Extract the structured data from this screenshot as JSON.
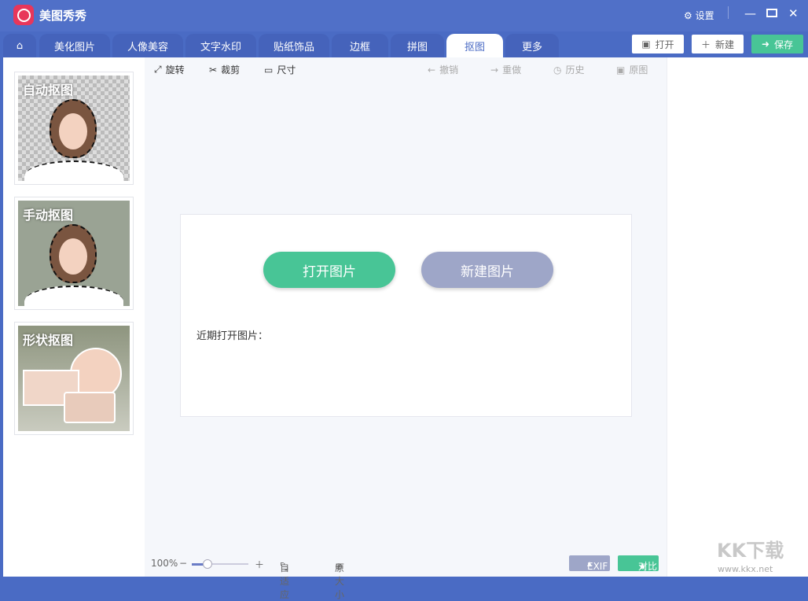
{
  "app": {
    "title": "美图秀秀",
    "settings": "设置"
  },
  "tabs": [
    "美化图片",
    "人像美容",
    "文字水印",
    "贴纸饰品",
    "边框",
    "拼图",
    "抠图",
    "更多"
  ],
  "active_tab": "抠图",
  "header_buttons": {
    "open": "打开",
    "new": "新建",
    "save": "保存"
  },
  "colors": {
    "titlebar": "#5070c8",
    "green": "#48c596",
    "gray_button": "#9ea6c8"
  },
  "sidebar": [
    {
      "label": "自动抠图"
    },
    {
      "label": "手动抠图"
    },
    {
      "label": "形状抠图"
    }
  ],
  "toolbar": {
    "rotate": "旋转",
    "crop": "裁剪",
    "size": "尺寸",
    "undo": "撤销",
    "redo": "重做",
    "history": "历史",
    "original": "原图"
  },
  "dialog": {
    "open_image": "打开图片",
    "new_image": "新建图片",
    "recent": "近期打开图片："
  },
  "bottom": {
    "zoom": "100%",
    "zoom_fraction": 0.28,
    "fit": "自适应",
    "actual_size": "原大小",
    "exif": "EXIF",
    "compare": "对比"
  },
  "watermark": {
    "text": "KK下载",
    "url": "www.kkx.net"
  }
}
